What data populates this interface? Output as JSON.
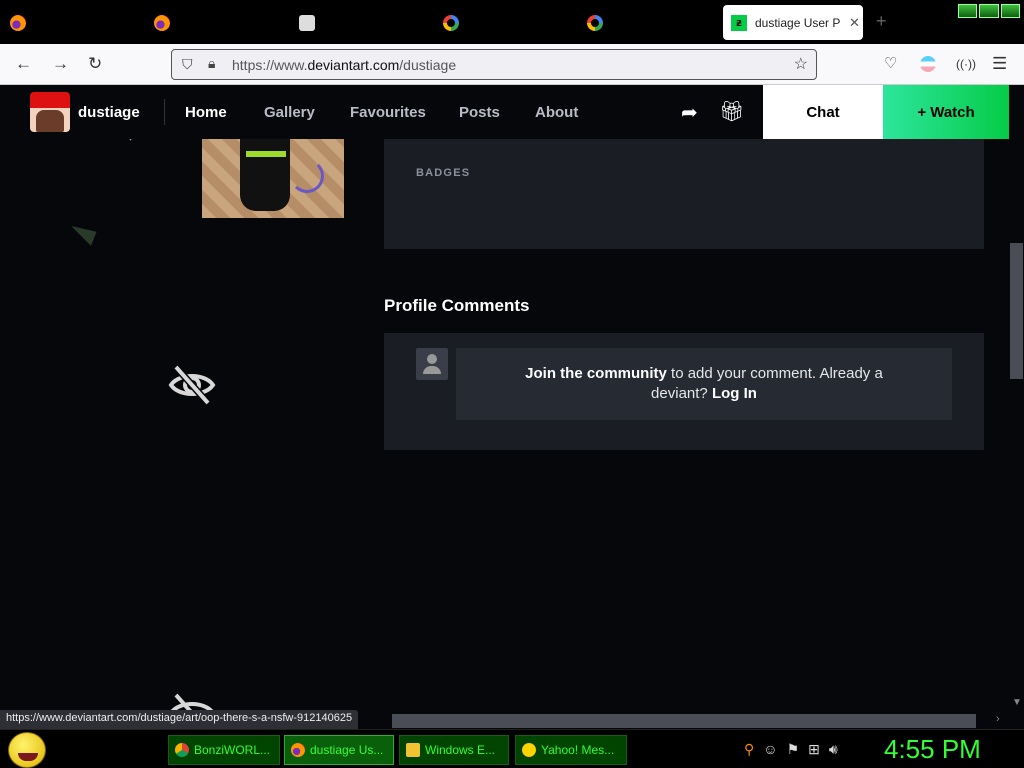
{
  "browser": {
    "tabs": [
      {
        "icon": "firefox-icon"
      },
      {
        "icon": "firefox-icon"
      },
      {
        "icon": "cat-icon"
      },
      {
        "icon": "google-icon"
      },
      {
        "icon": "google-icon"
      }
    ],
    "active_tab": {
      "title": "dustiage User P",
      "icon": "deviantart-icon"
    },
    "url_prefix": "https://www.",
    "url_domain": "deviantart.com",
    "url_path": "/dustiage"
  },
  "site": {
    "username": "dustiage",
    "nav": {
      "home": "Home",
      "gallery": "Gallery",
      "favourites": "Favourites",
      "posts": "Posts",
      "about": "About"
    },
    "chat_label": "Chat",
    "watch_label": "+ Watch"
  },
  "main": {
    "badges_title": "BADGES",
    "comments_title": "Profile Comments",
    "join_link": "Join the community",
    "join_text": " to add your comment. Already a deviant? ",
    "login_link": "Log In"
  },
  "status_url": "https://www.deviantart.com/dustiage/art/oop-there-s-a-nsfw-912140625",
  "taskbar": {
    "tasks": [
      {
        "label": "BonziWORL...",
        "icon": "chrome-icon"
      },
      {
        "label": "dustiage Us...",
        "icon": "firefox-icon"
      },
      {
        "label": "Windows E...",
        "icon": "folder-icon"
      },
      {
        "label": "Yahoo! Mes...",
        "icon": "yahoo-icon"
      }
    ],
    "clock": "4:55 PM"
  },
  "colors": {
    "accent": "#05cc47",
    "page_bg": "#06070b",
    "card_bg": "#1a1d24",
    "taskbar_text": "#33ff33"
  }
}
